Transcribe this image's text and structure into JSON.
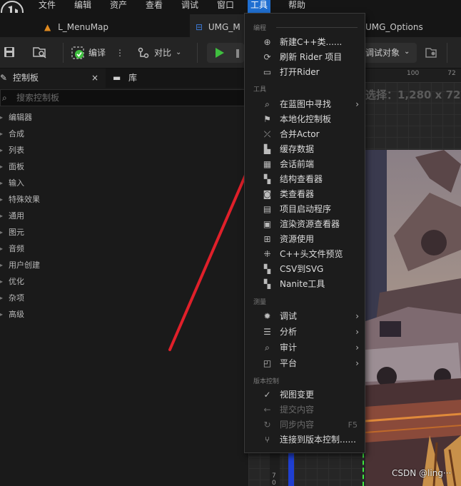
{
  "menubar": {
    "items": [
      "文件",
      "编辑",
      "资产",
      "查看",
      "调试",
      "窗口",
      "工具",
      "帮助"
    ],
    "active_index": 6
  },
  "tabs": [
    {
      "label": "L_MenuMap"
    },
    {
      "label": "UMG_M"
    },
    {
      "label": "UMG_Options"
    }
  ],
  "toolbar": {
    "compile_label": "编译",
    "diff_label": "对比",
    "debug_target_label": "调试对象"
  },
  "panel": {
    "tab_palette": "控制板",
    "tab_library": "库",
    "search_placeholder": "搜索控制板",
    "categories": [
      "编辑器",
      "合成",
      "列表",
      "面板",
      "输入",
      "特殊效果",
      "通用",
      "图元",
      "音频",
      "用户创建",
      "优化",
      "杂项",
      "高级"
    ]
  },
  "designer": {
    "selection_text": "选择：1,280 x 72"
  },
  "tools_menu": {
    "sections": {
      "programming": "编程",
      "tools": "工具",
      "instrumentation": "测量",
      "source_control": "版本控制"
    },
    "programming_items": [
      {
        "label": "新建C++类......",
        "icon": "new-class-icon"
      },
      {
        "label": "刷新 Rider 项目",
        "icon": "refresh-icon"
      },
      {
        "label": "打开Rider",
        "icon": "rider-icon"
      }
    ],
    "tools_items": [
      {
        "label": "在蓝图中寻找",
        "icon": "find-in-blueprints-icon",
        "submenu": true
      },
      {
        "label": "本地化控制板",
        "icon": "localization-flag-icon"
      },
      {
        "label": "合并Actor",
        "icon": "merge-actor-icon"
      },
      {
        "label": "缓存数据",
        "icon": "cache-stats-icon"
      },
      {
        "label": "会话前端",
        "icon": "session-frontend-icon"
      },
      {
        "label": "结构查看器",
        "icon": "struct-viewer-icon"
      },
      {
        "label": "类查看器",
        "icon": "class-viewer-icon"
      },
      {
        "label": "项目启动程序",
        "icon": "project-launcher-icon"
      },
      {
        "label": "渲染资源查看器",
        "icon": "render-resource-viewer-icon"
      },
      {
        "label": "资源使用",
        "icon": "resource-usage-icon"
      },
      {
        "label": "C++头文件预览",
        "icon": "header-preview-icon"
      },
      {
        "label": "CSV到SVG",
        "icon": "csv-to-svg-icon"
      },
      {
        "label": "Nanite工具",
        "icon": "nanite-tools-icon"
      }
    ],
    "instrumentation_items": [
      {
        "label": "调试",
        "icon": "debug-bug-icon",
        "submenu": true
      },
      {
        "label": "分析",
        "icon": "profile-bars-icon",
        "submenu": true
      },
      {
        "label": "审计",
        "icon": "audit-search-icon",
        "submenu": true
      },
      {
        "label": "平台",
        "icon": "platform-icon",
        "submenu": true
      }
    ],
    "source_control_items": [
      {
        "label": "视图变更",
        "icon": "check-circle-icon",
        "disabled": false
      },
      {
        "label": "提交内容",
        "icon": "arrow-left-icon",
        "disabled": true
      },
      {
        "label": "同步内容",
        "icon": "sync-icon",
        "disabled": true,
        "shortcut": "F5"
      },
      {
        "label": "连接到版本控制......",
        "icon": "branch-icon",
        "disabled": false
      }
    ]
  },
  "watermark": "CSDN @ling···",
  "colors": {
    "accent": "#1f6fd1",
    "annotation_arrow": "#e0202a",
    "play_green": "#3fbf3f",
    "selection_outline": "#3ee83e"
  }
}
